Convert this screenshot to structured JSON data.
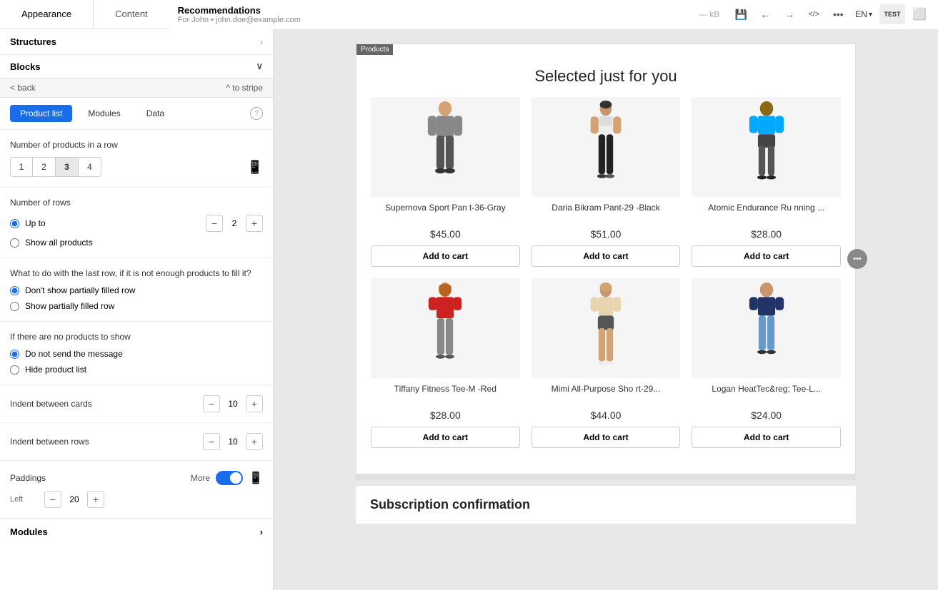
{
  "tabs": {
    "appearance": "Appearance",
    "content": "Content"
  },
  "header": {
    "title": "Recommendations",
    "subtitle": "For John  •  john.doe@example.com",
    "kb": "— kB",
    "lang": "EN"
  },
  "left_panel": {
    "structures_label": "Structures",
    "blocks_label": "Blocks",
    "back_label": "< back",
    "stripe_label": "^ to stripe",
    "sub_tabs": [
      "Product list",
      "Modules",
      "Data"
    ],
    "help_icon": "?",
    "sections": {
      "products_in_row": {
        "label": "Number of products in a row",
        "options": [
          "1",
          "2",
          "3",
          "4"
        ],
        "selected": "3"
      },
      "number_of_rows": {
        "label": "Number of rows",
        "up_to_label": "Up to",
        "show_all_label": "Show all products",
        "value": "2"
      },
      "last_row": {
        "label": "What to do with the last row, if it is not enough products to fill it?",
        "options": [
          "Don't show partially filled row",
          "Show partially filled row"
        ],
        "selected": 0
      },
      "no_products": {
        "label": "If there are no products to show",
        "options": [
          "Do not send the message",
          "Hide product list"
        ],
        "selected": 0
      },
      "indent_cards": {
        "label": "Indent between cards",
        "value": "10"
      },
      "indent_rows": {
        "label": "Indent between rows",
        "value": "10"
      },
      "paddings": {
        "label": "Paddings",
        "more_label": "More",
        "left_label": "Left",
        "left_value": "20"
      }
    }
  },
  "modules_footer": {
    "label": "Modules",
    "chevron": "›"
  },
  "email": {
    "products_tag": "Products",
    "heading": "Selected just for you",
    "products": [
      {
        "name": "Supernova Sport Pan t-36-Gray",
        "price": "$45.00",
        "btn": "Add to cart",
        "color": "#777",
        "gender": "male",
        "pants": true
      },
      {
        "name": "Daria Bikram Pant-29 -Black",
        "price": "$51.00",
        "btn": "Add to cart",
        "color": "#333",
        "gender": "female",
        "pants": true
      },
      {
        "name": "Atomic Endurance Ru nning ...",
        "price": "$28.00",
        "btn": "Add to cart",
        "color": "#00aaff",
        "gender": "male",
        "pants": false
      },
      {
        "name": "Tiffany Fitness Tee-M -Red",
        "price": "$28.00",
        "btn": "Add to cart",
        "color": "#cc2222",
        "gender": "female",
        "pants": false
      },
      {
        "name": "Mimi All-Purpose Sho rt-29...",
        "price": "$44.00",
        "btn": "Add to cart",
        "color": "#888",
        "gender": "female",
        "pants": true
      },
      {
        "name": "Logan HeatTec&reg; Tee-L...",
        "price": "$24.00",
        "btn": "Add to cart",
        "color": "#223366",
        "gender": "male",
        "pants": false
      }
    ],
    "subscription_title": "Subscription confirmation"
  },
  "icons": {
    "save": "💾",
    "undo": "←",
    "redo": "→",
    "code": "</>",
    "more": "•••",
    "test": "TEST",
    "mobile": "📱",
    "chevron_right": "›",
    "chevron_down": "∨",
    "chevron_up": "∧"
  }
}
